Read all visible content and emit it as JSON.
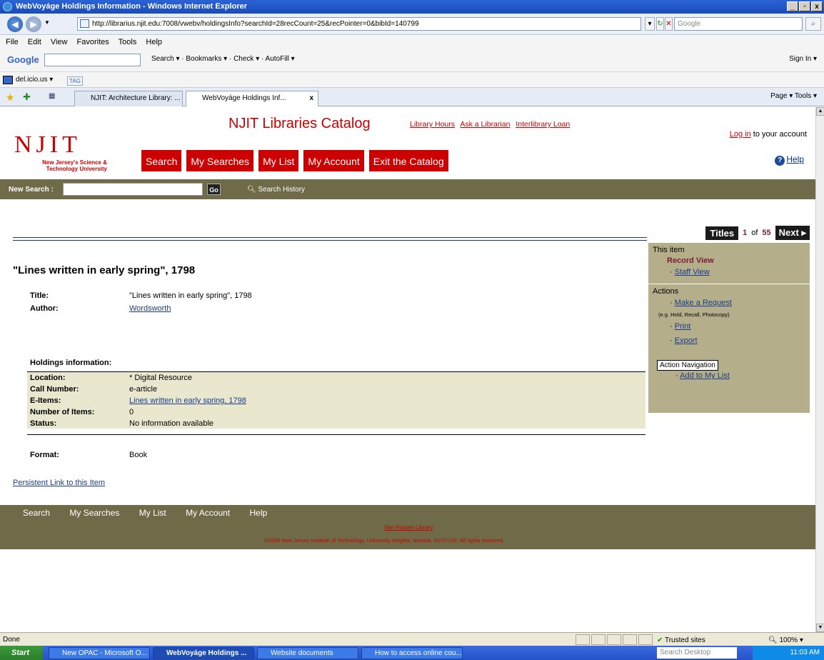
{
  "window": {
    "title": "WebVoyáge Holdings Information - Windows Internet Explorer",
    "controls": [
      "_",
      "▫",
      "x"
    ]
  },
  "browser": {
    "url": "http://librarius.njit.edu:7008/vwebv/holdingsInfo?searchId=28recCount=25&recPointer=0&bibId=140799",
    "search_placeholder": "Google",
    "menu": [
      "File",
      "Edit",
      "View",
      "Favorites",
      "Tools",
      "Help"
    ],
    "google_toolbar": {
      "logo": "Google",
      "items": "Search ▾  ·  Bookmarks ▾  ·  Check ▾  ·  AutoFill ▾",
      "sign_in": "Sign In ▾"
    },
    "delicious": "del.icio.us ▾",
    "tag": "TAG",
    "tabs": [
      {
        "label": "NJIT: Architecture Library: ..."
      },
      {
        "label": "WebVoyáge Holdings Inf...",
        "close": "x"
      }
    ],
    "tab_tools": "Page ▾   Tools ▾"
  },
  "page": {
    "catalog_title": "NJIT Libraries Catalog",
    "top_links": [
      "Library Hours",
      "Ask a Librarian",
      "Interlibrary Loan"
    ],
    "login_link": "Log in",
    "login_rest": " to your account",
    "help": "Help",
    "logo": {
      "letters": "NJIT",
      "subtitle": "New Jersey's Science & Technology University"
    },
    "nav_tabs": [
      "Search",
      "My Searches",
      "My List",
      "My Account",
      "Exit the Catalog"
    ],
    "search_bar": {
      "label": "New Search :",
      "go": "Go",
      "history": "Search History"
    },
    "pager": {
      "titles": "Titles",
      "current": "1",
      "of": "of",
      "total": "55",
      "next": "Next ▸"
    },
    "record_heading": "\"Lines written in early spring\", 1798",
    "fields": [
      {
        "label": "Title:",
        "value": "\"Lines written in early spring\", 1798"
      },
      {
        "label": "Author:",
        "value": "Wordsworth"
      }
    ],
    "holdings_heading": "Holdings information:",
    "holdings": [
      {
        "label": "Location:",
        "value": "* Digital Resource"
      },
      {
        "label": "Call Number:",
        "value": "e-article"
      },
      {
        "label": "E-Items:",
        "value": "Lines written in early spring, 1798"
      },
      {
        "label": "Number of Items:",
        "value": "0"
      },
      {
        "label": "Status:",
        "value": "No information available"
      }
    ],
    "format": {
      "label": "Format:",
      "value": "Book"
    },
    "persistent_link": "Persistent Link to this Item",
    "sidebar": {
      "this_item": "This item",
      "record_view": "Record View",
      "staff_view": "Staff View",
      "actions": "Actions",
      "make_request": "Make a Request",
      "request_note": "(e.g. Hold, Recall, Photocopy)",
      "print": "Print",
      "export": "Export",
      "add_list": "Add to My List"
    },
    "tooltip": "Action Navigation",
    "footer": {
      "links": [
        "Search",
        "My Searches",
        "My List",
        "My Account",
        "Help"
      ],
      "library": "Van Houten Library",
      "copyright": "©2009 New Jersey Institute of Technology, University Heights, Newark, NJ 07102. All rights reserved."
    }
  },
  "status": {
    "text": "Done",
    "zone": "Trusted sites",
    "zoom": "100%"
  },
  "taskbar": {
    "start": "Start",
    "items": [
      {
        "label": "New OPAC - Microsoft O..."
      },
      {
        "label": "WebVoyáge Holdings ..."
      },
      {
        "label": "Website documents"
      },
      {
        "label": "How to access online cou..."
      }
    ],
    "desktop_search": "Search Desktop",
    "clock": "11:03 AM"
  },
  "colors": {
    "brand_red": "#cc0000",
    "olive": "#6f6a48",
    "sidebar": "#b4ae8b",
    "holdings_bg": "#eae7cf"
  }
}
